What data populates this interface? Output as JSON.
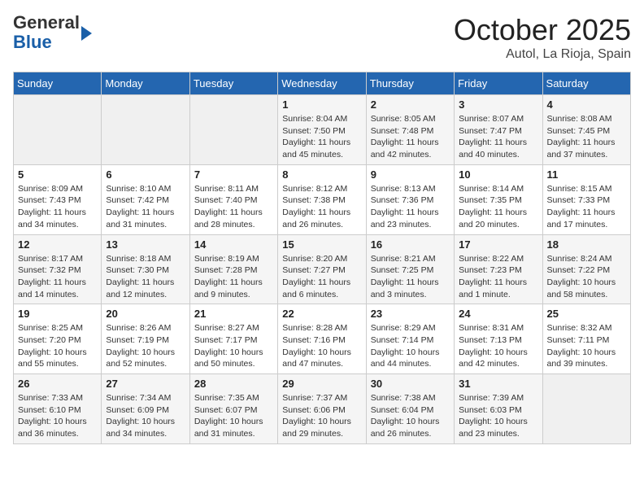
{
  "header": {
    "logo_general": "General",
    "logo_blue": "Blue",
    "month_title": "October 2025",
    "location": "Autol, La Rioja, Spain"
  },
  "days_of_week": [
    "Sunday",
    "Monday",
    "Tuesday",
    "Wednesday",
    "Thursday",
    "Friday",
    "Saturday"
  ],
  "weeks": [
    [
      {
        "day": "",
        "info": ""
      },
      {
        "day": "",
        "info": ""
      },
      {
        "day": "",
        "info": ""
      },
      {
        "day": "1",
        "info": "Sunrise: 8:04 AM\nSunset: 7:50 PM\nDaylight: 11 hours\nand 45 minutes."
      },
      {
        "day": "2",
        "info": "Sunrise: 8:05 AM\nSunset: 7:48 PM\nDaylight: 11 hours\nand 42 minutes."
      },
      {
        "day": "3",
        "info": "Sunrise: 8:07 AM\nSunset: 7:47 PM\nDaylight: 11 hours\nand 40 minutes."
      },
      {
        "day": "4",
        "info": "Sunrise: 8:08 AM\nSunset: 7:45 PM\nDaylight: 11 hours\nand 37 minutes."
      }
    ],
    [
      {
        "day": "5",
        "info": "Sunrise: 8:09 AM\nSunset: 7:43 PM\nDaylight: 11 hours\nand 34 minutes."
      },
      {
        "day": "6",
        "info": "Sunrise: 8:10 AM\nSunset: 7:42 PM\nDaylight: 11 hours\nand 31 minutes."
      },
      {
        "day": "7",
        "info": "Sunrise: 8:11 AM\nSunset: 7:40 PM\nDaylight: 11 hours\nand 28 minutes."
      },
      {
        "day": "8",
        "info": "Sunrise: 8:12 AM\nSunset: 7:38 PM\nDaylight: 11 hours\nand 26 minutes."
      },
      {
        "day": "9",
        "info": "Sunrise: 8:13 AM\nSunset: 7:36 PM\nDaylight: 11 hours\nand 23 minutes."
      },
      {
        "day": "10",
        "info": "Sunrise: 8:14 AM\nSunset: 7:35 PM\nDaylight: 11 hours\nand 20 minutes."
      },
      {
        "day": "11",
        "info": "Sunrise: 8:15 AM\nSunset: 7:33 PM\nDaylight: 11 hours\nand 17 minutes."
      }
    ],
    [
      {
        "day": "12",
        "info": "Sunrise: 8:17 AM\nSunset: 7:32 PM\nDaylight: 11 hours\nand 14 minutes."
      },
      {
        "day": "13",
        "info": "Sunrise: 8:18 AM\nSunset: 7:30 PM\nDaylight: 11 hours\nand 12 minutes."
      },
      {
        "day": "14",
        "info": "Sunrise: 8:19 AM\nSunset: 7:28 PM\nDaylight: 11 hours\nand 9 minutes."
      },
      {
        "day": "15",
        "info": "Sunrise: 8:20 AM\nSunset: 7:27 PM\nDaylight: 11 hours\nand 6 minutes."
      },
      {
        "day": "16",
        "info": "Sunrise: 8:21 AM\nSunset: 7:25 PM\nDaylight: 11 hours\nand 3 minutes."
      },
      {
        "day": "17",
        "info": "Sunrise: 8:22 AM\nSunset: 7:23 PM\nDaylight: 11 hours\nand 1 minute."
      },
      {
        "day": "18",
        "info": "Sunrise: 8:24 AM\nSunset: 7:22 PM\nDaylight: 10 hours\nand 58 minutes."
      }
    ],
    [
      {
        "day": "19",
        "info": "Sunrise: 8:25 AM\nSunset: 7:20 PM\nDaylight: 10 hours\nand 55 minutes."
      },
      {
        "day": "20",
        "info": "Sunrise: 8:26 AM\nSunset: 7:19 PM\nDaylight: 10 hours\nand 52 minutes."
      },
      {
        "day": "21",
        "info": "Sunrise: 8:27 AM\nSunset: 7:17 PM\nDaylight: 10 hours\nand 50 minutes."
      },
      {
        "day": "22",
        "info": "Sunrise: 8:28 AM\nSunset: 7:16 PM\nDaylight: 10 hours\nand 47 minutes."
      },
      {
        "day": "23",
        "info": "Sunrise: 8:29 AM\nSunset: 7:14 PM\nDaylight: 10 hours\nand 44 minutes."
      },
      {
        "day": "24",
        "info": "Sunrise: 8:31 AM\nSunset: 7:13 PM\nDaylight: 10 hours\nand 42 minutes."
      },
      {
        "day": "25",
        "info": "Sunrise: 8:32 AM\nSunset: 7:11 PM\nDaylight: 10 hours\nand 39 minutes."
      }
    ],
    [
      {
        "day": "26",
        "info": "Sunrise: 7:33 AM\nSunset: 6:10 PM\nDaylight: 10 hours\nand 36 minutes."
      },
      {
        "day": "27",
        "info": "Sunrise: 7:34 AM\nSunset: 6:09 PM\nDaylight: 10 hours\nand 34 minutes."
      },
      {
        "day": "28",
        "info": "Sunrise: 7:35 AM\nSunset: 6:07 PM\nDaylight: 10 hours\nand 31 minutes."
      },
      {
        "day": "29",
        "info": "Sunrise: 7:37 AM\nSunset: 6:06 PM\nDaylight: 10 hours\nand 29 minutes."
      },
      {
        "day": "30",
        "info": "Sunrise: 7:38 AM\nSunset: 6:04 PM\nDaylight: 10 hours\nand 26 minutes."
      },
      {
        "day": "31",
        "info": "Sunrise: 7:39 AM\nSunset: 6:03 PM\nDaylight: 10 hours\nand 23 minutes."
      },
      {
        "day": "",
        "info": ""
      }
    ]
  ]
}
